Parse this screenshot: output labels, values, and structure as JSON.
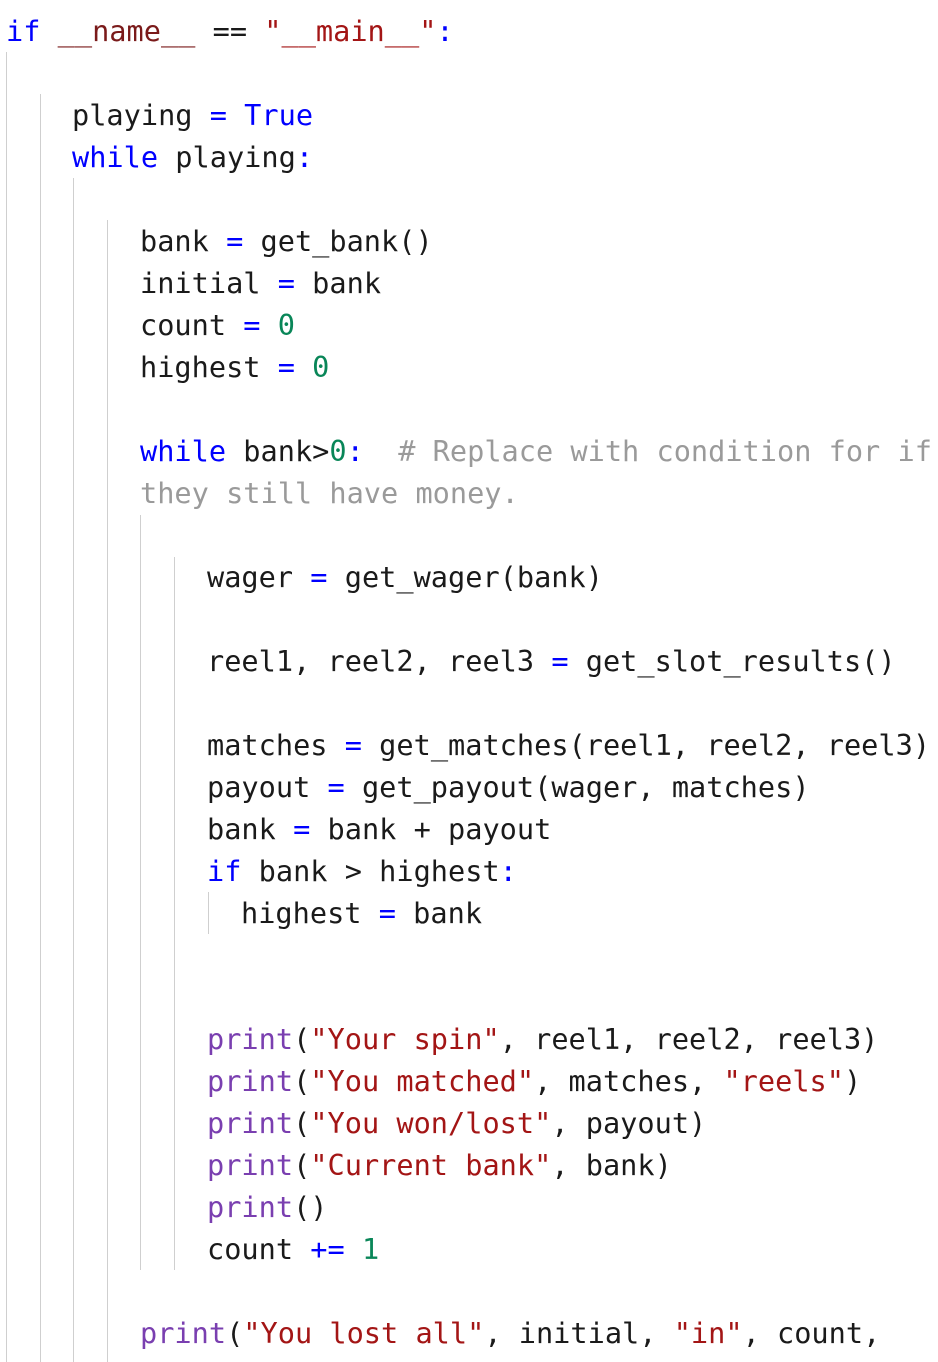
{
  "editor": {
    "language": "python",
    "lines": [
      {
        "indent": 0,
        "tokens": [
          {
            "t": "if",
            "c": "kw"
          },
          {
            "t": " ",
            "c": "txt"
          },
          {
            "t": "__name__",
            "c": "dunder"
          },
          {
            "t": " == ",
            "c": "txt"
          },
          {
            "t": "\"__main__\"",
            "c": "str"
          },
          {
            "t": ":",
            "c": "op"
          }
        ]
      },
      {
        "indent": 0,
        "tokens": []
      },
      {
        "indent": 1,
        "tokens": [
          {
            "t": "playing ",
            "c": "txt"
          },
          {
            "t": "=",
            "c": "op"
          },
          {
            "t": " ",
            "c": "txt"
          },
          {
            "t": "True",
            "c": "kw"
          }
        ]
      },
      {
        "indent": 1,
        "tokens": [
          {
            "t": "while",
            "c": "kw"
          },
          {
            "t": " playing",
            "c": "txt"
          },
          {
            "t": ":",
            "c": "op"
          }
        ]
      },
      {
        "indent": 0,
        "tokens": []
      },
      {
        "indent": 2,
        "tokens": [
          {
            "t": "bank ",
            "c": "txt"
          },
          {
            "t": "=",
            "c": "op"
          },
          {
            "t": " get_bank()",
            "c": "txt"
          }
        ]
      },
      {
        "indent": 2,
        "tokens": [
          {
            "t": "initial ",
            "c": "txt"
          },
          {
            "t": "=",
            "c": "op"
          },
          {
            "t": " bank",
            "c": "txt"
          }
        ]
      },
      {
        "indent": 2,
        "tokens": [
          {
            "t": "count ",
            "c": "txt"
          },
          {
            "t": "=",
            "c": "op"
          },
          {
            "t": " ",
            "c": "txt"
          },
          {
            "t": "0",
            "c": "num"
          }
        ]
      },
      {
        "indent": 2,
        "tokens": [
          {
            "t": "highest ",
            "c": "txt"
          },
          {
            "t": "=",
            "c": "op"
          },
          {
            "t": " ",
            "c": "txt"
          },
          {
            "t": "0",
            "c": "num"
          }
        ]
      },
      {
        "indent": 0,
        "tokens": []
      },
      {
        "indent": 2,
        "tokens": [
          {
            "t": "while",
            "c": "kw"
          },
          {
            "t": " bank>",
            "c": "txt"
          },
          {
            "t": "0",
            "c": "num"
          },
          {
            "t": ":",
            "c": "op"
          },
          {
            "t": "  ",
            "c": "txt"
          },
          {
            "t": "# Replace with condition for if",
            "c": "cm"
          }
        ]
      },
      {
        "indent": 2,
        "tokens": [
          {
            "t": "they still have money.",
            "c": "cm"
          }
        ]
      },
      {
        "indent": 0,
        "tokens": []
      },
      {
        "indent": 3,
        "tokens": [
          {
            "t": "wager ",
            "c": "txt"
          },
          {
            "t": "=",
            "c": "op"
          },
          {
            "t": " get_wager(bank)",
            "c": "txt"
          }
        ]
      },
      {
        "indent": 0,
        "tokens": []
      },
      {
        "indent": 3,
        "tokens": [
          {
            "t": "reel1, reel2, reel3 ",
            "c": "txt"
          },
          {
            "t": "=",
            "c": "op"
          },
          {
            "t": " get_slot_results()",
            "c": "txt"
          }
        ]
      },
      {
        "indent": 0,
        "tokens": []
      },
      {
        "indent": 3,
        "tokens": [
          {
            "t": "matches ",
            "c": "txt"
          },
          {
            "t": "=",
            "c": "op"
          },
          {
            "t": " get_matches(reel1, reel2, reel3)",
            "c": "txt"
          }
        ]
      },
      {
        "indent": 3,
        "tokens": [
          {
            "t": "payout ",
            "c": "txt"
          },
          {
            "t": "=",
            "c": "op"
          },
          {
            "t": " get_payout(wager, matches)",
            "c": "txt"
          }
        ]
      },
      {
        "indent": 3,
        "tokens": [
          {
            "t": "bank ",
            "c": "txt"
          },
          {
            "t": "=",
            "c": "op"
          },
          {
            "t": " bank + payout",
            "c": "txt"
          }
        ]
      },
      {
        "indent": 3,
        "tokens": [
          {
            "t": "if",
            "c": "kw"
          },
          {
            "t": " bank > highest",
            "c": "txt"
          },
          {
            "t": ":",
            "c": "op"
          }
        ]
      },
      {
        "indent": 4,
        "tokens": [
          {
            "t": "highest ",
            "c": "txt"
          },
          {
            "t": "=",
            "c": "op"
          },
          {
            "t": " bank",
            "c": "txt"
          }
        ]
      },
      {
        "indent": 0,
        "tokens": []
      },
      {
        "indent": 0,
        "tokens": []
      },
      {
        "indent": 3,
        "tokens": [
          {
            "t": "print",
            "c": "fn"
          },
          {
            "t": "(",
            "c": "txt"
          },
          {
            "t": "\"Your spin\"",
            "c": "str"
          },
          {
            "t": ", reel1, reel2, reel3)",
            "c": "txt"
          }
        ]
      },
      {
        "indent": 3,
        "tokens": [
          {
            "t": "print",
            "c": "fn"
          },
          {
            "t": "(",
            "c": "txt"
          },
          {
            "t": "\"You matched\"",
            "c": "str"
          },
          {
            "t": ", matches, ",
            "c": "txt"
          },
          {
            "t": "\"reels\"",
            "c": "str"
          },
          {
            "t": ")",
            "c": "txt"
          }
        ]
      },
      {
        "indent": 3,
        "tokens": [
          {
            "t": "print",
            "c": "fn"
          },
          {
            "t": "(",
            "c": "txt"
          },
          {
            "t": "\"You won/lost\"",
            "c": "str"
          },
          {
            "t": ", payout)",
            "c": "txt"
          }
        ]
      },
      {
        "indent": 3,
        "tokens": [
          {
            "t": "print",
            "c": "fn"
          },
          {
            "t": "(",
            "c": "txt"
          },
          {
            "t": "\"Current bank\"",
            "c": "str"
          },
          {
            "t": ", bank)",
            "c": "txt"
          }
        ]
      },
      {
        "indent": 3,
        "tokens": [
          {
            "t": "print",
            "c": "fn"
          },
          {
            "t": "()",
            "c": "txt"
          }
        ]
      },
      {
        "indent": 3,
        "tokens": [
          {
            "t": "count ",
            "c": "txt"
          },
          {
            "t": "+=",
            "c": "op"
          },
          {
            "t": " ",
            "c": "txt"
          },
          {
            "t": "1",
            "c": "num"
          }
        ]
      },
      {
        "indent": 0,
        "tokens": []
      },
      {
        "indent": 2,
        "tokens": [
          {
            "t": "print",
            "c": "fn"
          },
          {
            "t": "(",
            "c": "txt"
          },
          {
            "t": "\"You lost all\"",
            "c": "str"
          },
          {
            "t": ", initial, ",
            "c": "txt"
          },
          {
            "t": "\"in\"",
            "c": "str"
          },
          {
            "t": ", count,",
            "c": "txt"
          }
        ]
      }
    ]
  }
}
